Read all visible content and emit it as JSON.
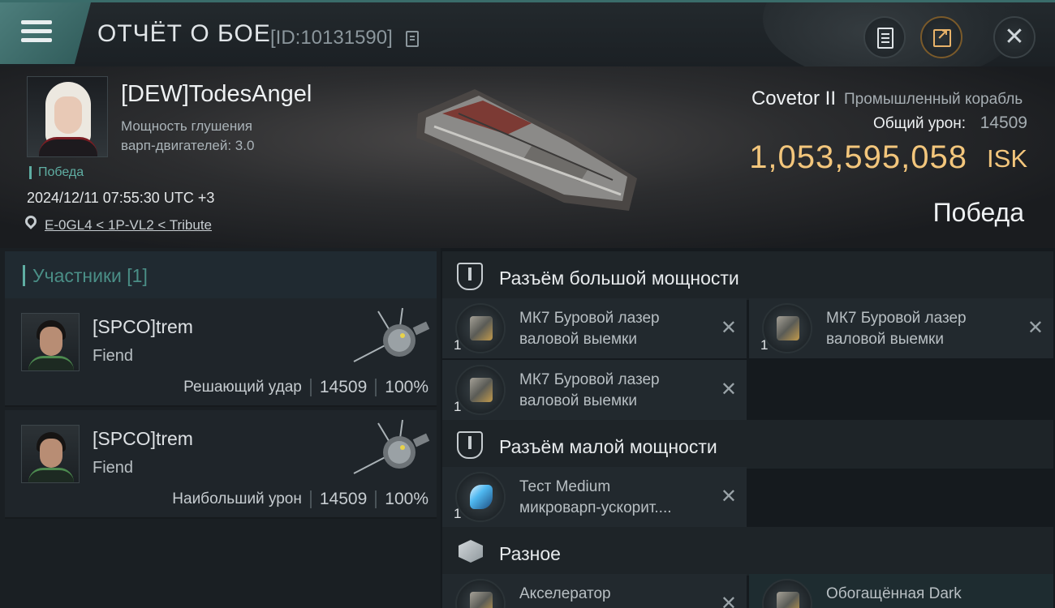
{
  "header": {
    "title": "ОТЧЁТ О БОЕ",
    "report_id": "[ID:10131590]"
  },
  "victim": {
    "name": "[DEW]TodesAngel",
    "jam_label_line1": "Мощность глушения",
    "jam_label_line2": "варп-двигателей: 3.0",
    "result_small": "Победа",
    "timestamp": "2024/12/11 07:55:30 UTC +3",
    "location": "E-0GL4 < 1P-VL2 < Tribute",
    "ship_name": "Covetor II",
    "ship_class": "Промышленный корабль",
    "total_damage_label": "Общий урон:",
    "total_damage": "14509",
    "isk_value": "1,053,595,058",
    "isk_unit": "ISK",
    "result_big": "Победа"
  },
  "participants": {
    "header": "Участники [1]",
    "items": [
      {
        "name": "[SPCO]trem",
        "ship": "Fiend",
        "role": "Решающий удар",
        "damage": "14509",
        "percent": "100%"
      },
      {
        "name": "[SPCO]trem",
        "ship": "Fiend",
        "role": "Наибольший урон",
        "damage": "14509",
        "percent": "100%"
      }
    ]
  },
  "fitting": {
    "high_slot_label": "Разъём большой мощности",
    "mid_slot_label": "Разъём малой мощности",
    "misc_label": "Разное",
    "high": [
      {
        "line1": "МК7 Буровой лазер",
        "line2": "валовой выемки",
        "qty": "1",
        "remove": "✕"
      },
      {
        "line1": "МК7 Буровой лазер",
        "line2": "валовой выемки",
        "qty": "1",
        "remove": "✕"
      },
      {
        "line1": "МК7 Буровой лазер",
        "line2": "валовой выемки",
        "qty": "1",
        "remove": "✕"
      }
    ],
    "mid": [
      {
        "line1": "Тест Medium",
        "line2": "микроварп-ускорит....",
        "qty": "1",
        "remove": "✕"
      }
    ],
    "misc": [
      {
        "line1": "Акселератор",
        "line2": "",
        "remove": "✕"
      },
      {
        "line1": "Обогащённая Dark",
        "line2": ""
      }
    ]
  },
  "icons": {
    "menu": "menu-icon",
    "copy": "copy-icon",
    "doc": "document-icon",
    "share": "share-icon",
    "close": "close-icon",
    "location": "location-pin-icon",
    "slot": "slot-icon",
    "cargo": "cargo-box-icon"
  },
  "colors": {
    "accent": "#5faea3",
    "isk": "#f3c67c",
    "header_tab": "#4d7e7c"
  }
}
